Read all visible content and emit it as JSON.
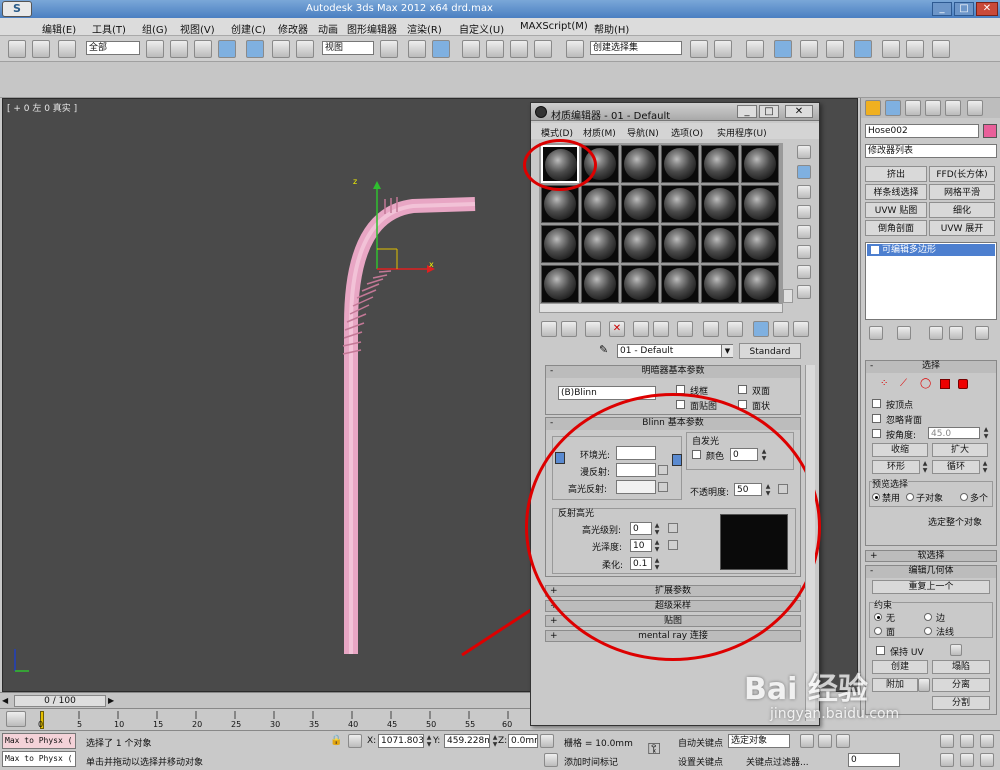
{
  "title_bar": {
    "title": "Autodesk 3ds Max  2012 x64      drd.max"
  },
  "menu": [
    "编辑(E)",
    "工具(T)",
    "组(G)",
    "视图(V)",
    "创建(C)",
    "修改器",
    "动画",
    "图形编辑器",
    "渲染(R)",
    "自定义(U)",
    "MAXScript(M)",
    "帮助(H)"
  ],
  "toolbar": {
    "selection_filter": "全部",
    "ref_coord": "视图",
    "named_selection": "创建选择集"
  },
  "viewport": {
    "label": "[ + 0 左 0 真实 ]",
    "axis_x": "x",
    "axis_z": "z"
  },
  "mat_editor": {
    "title": "材质编辑器 - 01 - Default",
    "menus": [
      "模式(D)",
      "材质(M)",
      "导航(N)",
      "选项(O)",
      "实用程序(U)"
    ],
    "material_name": "01 - Default",
    "material_type": "Standard",
    "shader_rollout": {
      "title": "明暗器基本参数",
      "shader": "(B)Blinn",
      "wire": "线框",
      "two_sided": "双面",
      "face_map": "面贴图",
      "faceted": "面状"
    },
    "blinn_rollout": {
      "title": "Blinn 基本参数",
      "self_illum": "自发光",
      "color": "颜色",
      "color_value": "0",
      "ambient": "环境光:",
      "diffuse": "漫反射:",
      "specular": "高光反射:",
      "opacity": "不透明度:",
      "opacity_value": "50",
      "spec_highlights": "反射高光",
      "spec_level": "高光级别:",
      "spec_level_value": "0",
      "glossiness": "光泽度:",
      "glossiness_value": "10",
      "soften": "柔化:",
      "soften_value": "0.1"
    },
    "collapsed_rollouts": [
      "扩展参数",
      "超级采样",
      "贴图",
      "mental ray 连接"
    ]
  },
  "cmd_panel": {
    "object_name": "Hose002",
    "modifier_list": "修改器列表",
    "buttons": [
      "挤出",
      "FFD(长方体)",
      "样条线选择",
      "网格平滑",
      "UVW 贴图",
      "细化",
      "倒角剖面",
      "UVW 展开"
    ],
    "stack_item": "可编辑多边形",
    "selection": {
      "title": "选择",
      "by_vertex": "按顶点",
      "ignore_backface": "忽略背面",
      "by_angle": "按角度:",
      "angle_value": "45.0",
      "shrink": "收缩",
      "grow": "扩大",
      "ring": "环形",
      "loop": "循环",
      "preview": "预览选择",
      "disabled": "禁用",
      "subobject": "子对象",
      "multi": "多个",
      "whole_object": "选定整个对象"
    },
    "soft_selection": "软选择",
    "edit_geometry": "编辑几何体",
    "repeat_last": "重复上一个",
    "constraints": "约束",
    "none": "无",
    "edge": "边",
    "face": "面",
    "normal": "法线",
    "preserve_uv": "保持 UV",
    "create": "创建",
    "collapse": "塌陷",
    "attach": "附加",
    "detach": "分离",
    "slice_split": "分割"
  },
  "timeline": {
    "frame": "0 / 100",
    "ticks": [
      "0",
      "5",
      "10",
      "15",
      "20",
      "25",
      "30",
      "35",
      "40",
      "45",
      "50",
      "55",
      "60"
    ]
  },
  "status": {
    "script_listener": "Max to Physx (",
    "selected": "选择了 1 个对象",
    "prompt": "单击并拖动以选择并移动对象",
    "x_label": "X:",
    "x_value": "1071.803m",
    "y_label": "Y:",
    "y_value": "459.228mr",
    "z_label": "Z:",
    "z_value": "0.0mm",
    "grid": "栅格 = 10.0mm",
    "add_time_tag": "添加时间标记",
    "auto_key": "自动关键点",
    "selected_obj": "选定对象",
    "set_key": "设置关键点",
    "key_filters": "关键点过滤器...",
    "frame_value": "0"
  },
  "watermark": {
    "brand": "Bai 经验",
    "url": "jingyan.baidu.com"
  },
  "colors": {
    "hose": "#e8a6c4",
    "annotation": "#dd0000",
    "viewport_bg": "#4a4a4a",
    "mat_bg": "#c9c9c9"
  }
}
